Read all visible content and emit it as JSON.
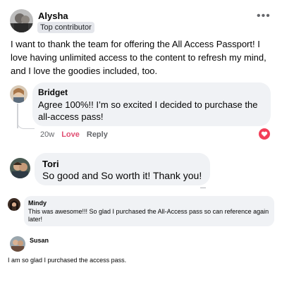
{
  "post": {
    "author": "Alysha",
    "badge": "Top contributor",
    "more_icon": "more-horizontal-icon",
    "text": "I want to thank the team for offering the All Access Passport! I love having unlimited access to the content to refresh my mind, and I love the goodies included, too."
  },
  "comments": [
    {
      "name": "Bridget",
      "text": "Agree 100%!! I’m so excited I decided to purchase the all-access pass!",
      "time": "20w",
      "reaction_label": "Love",
      "reply_label": "Reply",
      "reaction_icon": "heart-icon"
    },
    {
      "name": "Tori",
      "text": "So good and So worth it! Thank you!"
    },
    {
      "name": "Mindy",
      "text": "This was awesome!!! So glad I purchased the All-Access pass so can reference again later!"
    },
    {
      "name": "Susan",
      "text": "I am so glad I purchased the access pass."
    }
  ],
  "colors": {
    "bubble": "#f0f2f5",
    "love": "#e04e72",
    "meta": "#65676b"
  }
}
